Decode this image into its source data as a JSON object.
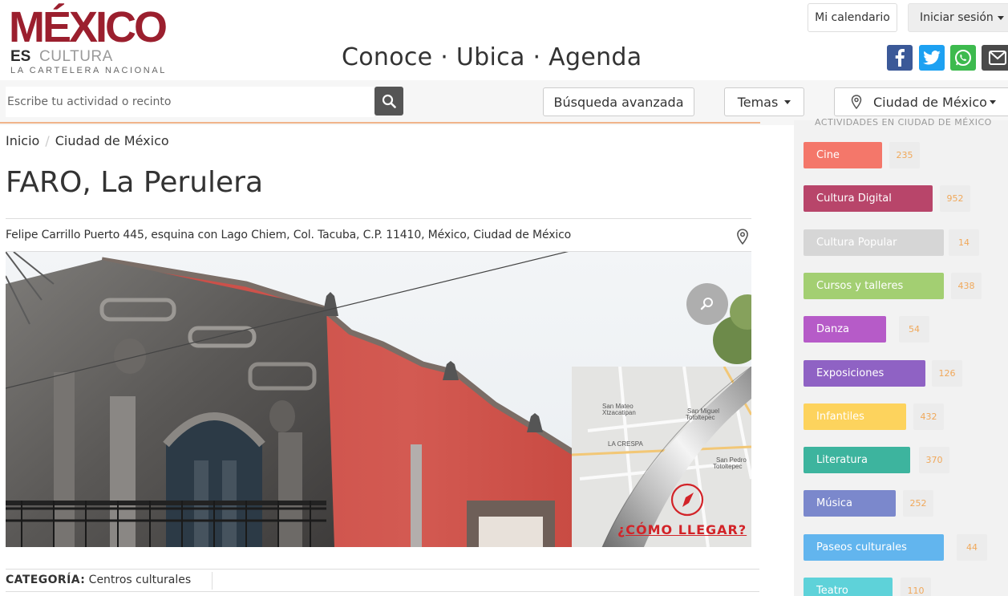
{
  "header": {
    "logo": {
      "main": "MÉXICO",
      "es": "ES",
      "cultura": "CULTURA",
      "sub": "LA CARTELERA NACIONAL"
    },
    "tagline": "Conoce · Ubica · Agenda",
    "calendar_label": "Mi calendario",
    "login_label": "Iniciar sesión",
    "social": [
      {
        "name": "facebook-icon",
        "color": "#3b5998"
      },
      {
        "name": "twitter-icon",
        "color": "#1da1f2"
      },
      {
        "name": "whatsapp-icon",
        "color": "#3dba4e"
      },
      {
        "name": "mail-icon",
        "color": "#4a4a4a"
      }
    ]
  },
  "search": {
    "placeholder": "Escribe tu actividad o recinto",
    "advanced_label": "Búsqueda avanzada",
    "temas_label": "Temas",
    "city_label": "Ciudad de México"
  },
  "breadcrumb": {
    "home": "Inicio",
    "sep": "/",
    "current": "Ciudad de México"
  },
  "venue": {
    "title": "FARO, La Perulera",
    "address": "Felipe Carrillo Puerto 445, esquina con Lago Chiem, Col. Tacuba, C.P. 11410, México, Ciudad de México",
    "category_label": "CATEGORÍA:",
    "category_value": "Centros culturales"
  },
  "map": {
    "labels": [
      "San Mateo",
      "Xtzacatipan",
      "San Miguel",
      "Totoltepec",
      "LA CRESPA",
      "San Pedro",
      "Totoltepec"
    ],
    "cta": "¿CÓMO LLEGAR?"
  },
  "sidebar": {
    "title": "ACTIVIDADES EN CIUDAD DE MÉXICO",
    "categories": [
      {
        "label": "Cine",
        "count": "235",
        "color": "#f4776a"
      },
      {
        "label": "Cultura Digital",
        "count": "952",
        "color": "#b8456a"
      },
      {
        "label": "Cultura Popular",
        "count": "14",
        "color": "#d6d6d6"
      },
      {
        "label": "Cursos y talleres",
        "count": "438",
        "color": "#a3cf72"
      },
      {
        "label": "Danza",
        "count": "54",
        "color": "#b65bc8"
      },
      {
        "label": "Exposiciones",
        "count": "126",
        "color": "#8f62c4"
      },
      {
        "label": "Infantiles",
        "count": "432",
        "color": "#fdd35d"
      },
      {
        "label": "Literatura",
        "count": "370",
        "color": "#3db49e"
      },
      {
        "label": "Música",
        "count": "252",
        "color": "#7b88cc"
      },
      {
        "label": "Paseos culturales",
        "count": "44",
        "color": "#62b5ee"
      },
      {
        "label": "Teatro",
        "count": "110",
        "color": "#5ed2d9"
      }
    ]
  }
}
